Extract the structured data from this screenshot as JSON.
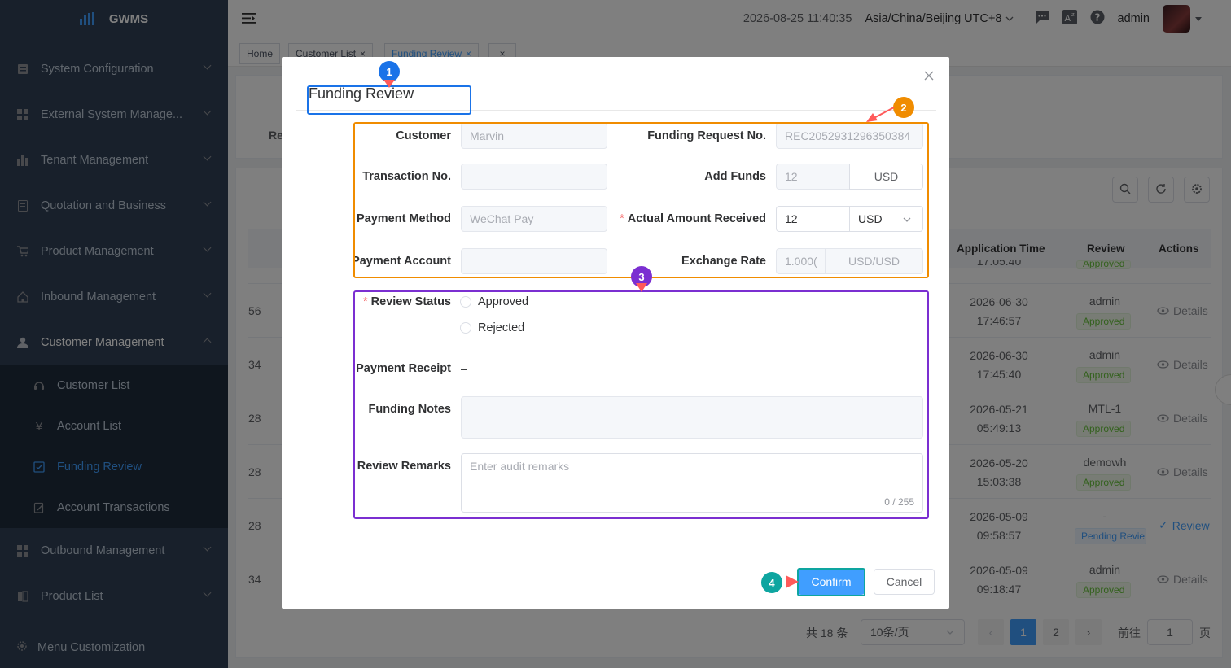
{
  "app": {
    "name": "GWMS"
  },
  "sidebar": {
    "items": [
      {
        "label": "System Configuration",
        "icon": "server-icon"
      },
      {
        "label": "External System Manage...",
        "icon": "grid-icon"
      },
      {
        "label": "Tenant Management",
        "icon": "bar-chart-icon"
      },
      {
        "label": "Quotation and Business",
        "icon": "document-icon"
      },
      {
        "label": "Product Management",
        "icon": "cart-icon"
      },
      {
        "label": "Inbound Management",
        "icon": "home-icon"
      },
      {
        "label": "Customer Management",
        "icon": "user-icon"
      }
    ],
    "sub_items": [
      {
        "label": "Customer List",
        "icon": "customer-service-icon"
      },
      {
        "label": "Account List",
        "icon": "yen-icon"
      },
      {
        "label": "Funding Review",
        "icon": "checkbox-icon"
      },
      {
        "label": "Account Transactions",
        "icon": "edit-doc-icon"
      }
    ],
    "items_after": [
      {
        "label": "Outbound Management",
        "icon": "grid-icon"
      },
      {
        "label": "Product List",
        "icon": "book-icon"
      }
    ],
    "menu_customization": "Menu Customization"
  },
  "header": {
    "datetime": "2026-08-25 11:40:35",
    "timezone": "Asia/China/Beijing UTC+8",
    "user": "admin"
  },
  "tags": [
    {
      "label": "Home"
    },
    {
      "label": "Customer List"
    },
    {
      "label": "Funding Review"
    }
  ],
  "table": {
    "partial_label": "Re",
    "columns": {
      "application_time": "Application Time",
      "review": "Review",
      "actions": "Actions"
    },
    "top_partial": {
      "time": "17:05:40",
      "status": "Approved"
    },
    "rows": [
      {
        "id_tail": "56",
        "date": "2026-06-30",
        "time": "17:46:57",
        "reviewer": "admin",
        "status": "Approved",
        "action": "Details"
      },
      {
        "id_tail": "34",
        "date": "2026-06-30",
        "time": "17:45:40",
        "reviewer": "admin",
        "status": "Approved",
        "action": "Details"
      },
      {
        "id_tail": "28",
        "date": "2026-05-21",
        "time": "05:49:13",
        "reviewer": "MTL-1",
        "status": "Approved",
        "action": "Details"
      },
      {
        "id_tail": "28",
        "date": "2026-05-20",
        "time": "15:03:38",
        "reviewer": "demowh",
        "status": "Approved",
        "action": "Details"
      },
      {
        "id_tail": "28",
        "date": "2026-05-09",
        "time": "09:58:57",
        "reviewer": "-",
        "status": "Pending Revie",
        "action": "Review"
      },
      {
        "id_tail": "34",
        "date": "2026-05-09",
        "time": "09:18:47",
        "reviewer": "admin",
        "status": "Approved",
        "action": "Details"
      }
    ]
  },
  "pagination": {
    "total": "共 18 条",
    "page_size": "10条/页",
    "pages": [
      "1",
      "2"
    ],
    "goto_label": "前往",
    "goto_value": "1",
    "page_suffix": "页"
  },
  "dialog": {
    "title": "Funding Review",
    "fields": {
      "customer_label": "Customer",
      "customer_value": "Marvin",
      "request_no_label": "Funding Request No.",
      "request_no_value": "REC2052931296350384",
      "transaction_no_label": "Transaction No.",
      "transaction_no_value": "",
      "add_funds_label": "Add Funds",
      "add_funds_value": "12",
      "add_funds_currency": "USD",
      "payment_method_label": "Payment Method",
      "payment_method_value": "WeChat Pay",
      "actual_amount_label": "Actual Amount Received",
      "actual_amount_value": "12",
      "actual_amount_currency": "USD",
      "payment_account_label": "Payment Account",
      "payment_account_value": "",
      "exchange_rate_label": "Exchange Rate",
      "exchange_rate_value": "1.000(",
      "exchange_rate_pair": "USD/USD",
      "review_status_label": "Review Status",
      "approved": "Approved",
      "rejected": "Rejected",
      "payment_receipt_label": "Payment Receipt",
      "payment_receipt_value": "–",
      "funding_notes_label": "Funding Notes",
      "review_remarks_label": "Review Remarks",
      "review_remarks_placeholder": "Enter audit remarks",
      "review_remarks_count": "0 / 255"
    },
    "confirm": "Confirm",
    "cancel": "Cancel"
  },
  "annotations": [
    {
      "num": "1",
      "color": "#1a73e8"
    },
    {
      "num": "2",
      "color": "#f08c00"
    },
    {
      "num": "3",
      "color": "#7b2fd1"
    },
    {
      "num": "4",
      "color": "#0ea5a0"
    }
  ]
}
